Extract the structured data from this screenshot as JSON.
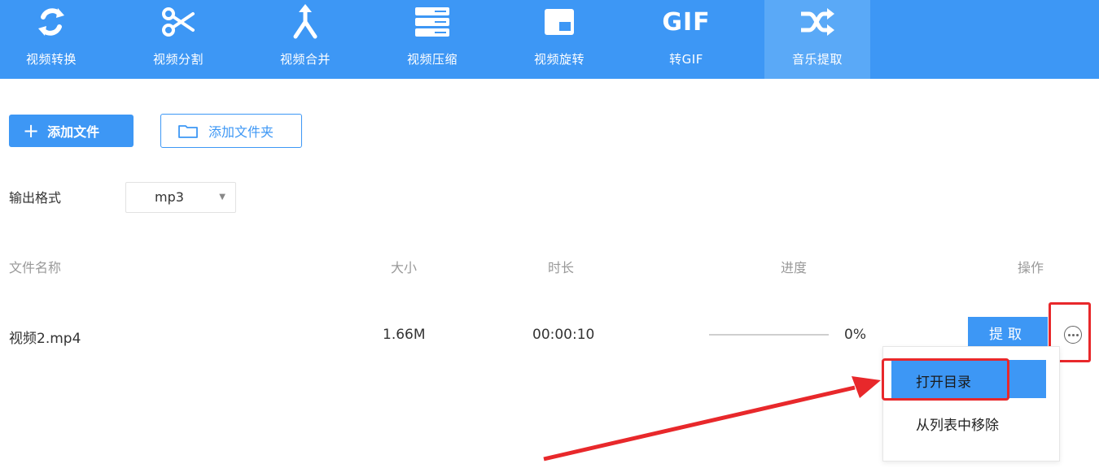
{
  "toolbar": {
    "items": [
      {
        "label": "视频转换",
        "icon": "convert-icon"
      },
      {
        "label": "视频分割",
        "icon": "scissors-icon"
      },
      {
        "label": "视频合并",
        "icon": "merge-icon"
      },
      {
        "label": "视频压缩",
        "icon": "compress-icon"
      },
      {
        "label": "视频旋转",
        "icon": "rotate-icon"
      },
      {
        "label": "转GIF",
        "icon": "gif-icon",
        "icon_text": "GIF"
      },
      {
        "label": "音乐提取",
        "icon": "shuffle-icon",
        "active": true
      }
    ]
  },
  "actions": {
    "add_file": "添加文件",
    "add_folder": "添加文件夹"
  },
  "format": {
    "label": "输出格式",
    "value": "mp3"
  },
  "table": {
    "headers": {
      "name": "文件名称",
      "size": "大小",
      "duration": "时长",
      "progress": "进度",
      "operation": "操作"
    },
    "rows": [
      {
        "name": "视频2.mp4",
        "size": "1.66M",
        "duration": "00:00:10",
        "progress_text": "0%",
        "progress_value": 0,
        "action": "提取"
      }
    ]
  },
  "menu": {
    "items": [
      "打开目录",
      "从列表中移除"
    ]
  },
  "colors": {
    "accent": "#3d97f5",
    "highlight": "#e8282b"
  }
}
